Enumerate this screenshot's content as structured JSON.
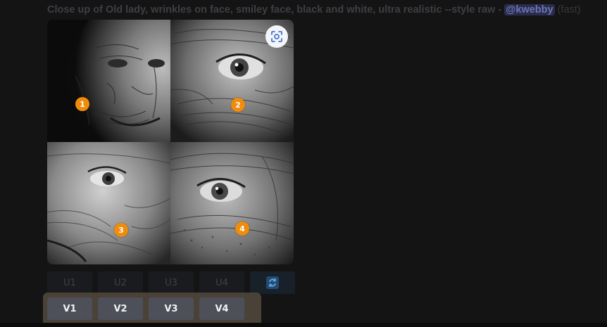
{
  "message": {
    "prompt": "Close up of Old lady, wrinkles on face, smiley face, black and white, ultra realistic --style raw",
    "separator": " - ",
    "mention": "@kwebby",
    "speed": "(fast)"
  },
  "grid": {
    "badges": [
      "1",
      "2",
      "3",
      "4"
    ]
  },
  "actions": {
    "upscale": [
      "U1",
      "U2",
      "U3",
      "U4"
    ],
    "variation": [
      "V1",
      "V2",
      "V3",
      "V4"
    ],
    "refresh_icon": "refresh-icon",
    "scan_icon": "image-scan-icon"
  },
  "colors": {
    "badge": "#f08c0c",
    "highlight": "#4a4237",
    "mention_bg": "#2a2d4a"
  }
}
